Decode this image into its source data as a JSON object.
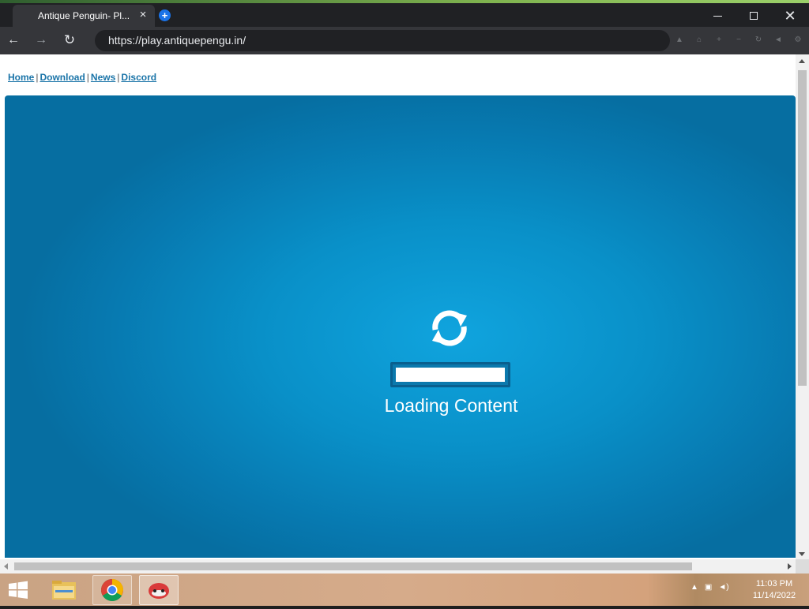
{
  "browser": {
    "tab_title": "Antique Penguin- Pl...",
    "url": "https://play.antiquepengu.in/"
  },
  "page": {
    "nav_links": [
      "Home",
      "Download",
      "News",
      "Discord"
    ],
    "loading_text": "Loading Content",
    "loading_progress": 1.0
  },
  "taskbar": {
    "time": "11:03 PM",
    "date": "11/14/2022"
  },
  "colors": {
    "game_background": "#0990c8",
    "link": "#1a74a8"
  }
}
